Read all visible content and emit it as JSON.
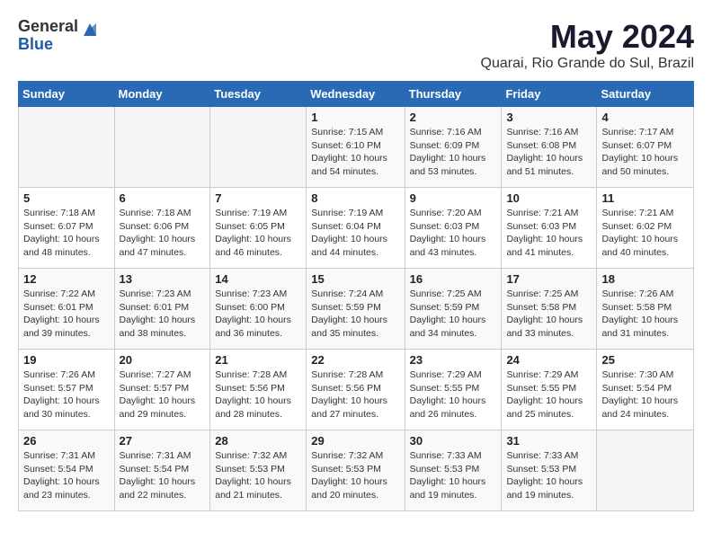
{
  "logo": {
    "line1": "General",
    "line2": "Blue"
  },
  "title": "May 2024",
  "subtitle": "Quarai, Rio Grande do Sul, Brazil",
  "weekdays": [
    "Sunday",
    "Monday",
    "Tuesday",
    "Wednesday",
    "Thursday",
    "Friday",
    "Saturday"
  ],
  "weeks": [
    [
      {
        "day": "",
        "sunrise": "",
        "sunset": "",
        "daylight": ""
      },
      {
        "day": "",
        "sunrise": "",
        "sunset": "",
        "daylight": ""
      },
      {
        "day": "",
        "sunrise": "",
        "sunset": "",
        "daylight": ""
      },
      {
        "day": "1",
        "sunrise": "Sunrise: 7:15 AM",
        "sunset": "Sunset: 6:10 PM",
        "daylight": "Daylight: 10 hours and 54 minutes."
      },
      {
        "day": "2",
        "sunrise": "Sunrise: 7:16 AM",
        "sunset": "Sunset: 6:09 PM",
        "daylight": "Daylight: 10 hours and 53 minutes."
      },
      {
        "day": "3",
        "sunrise": "Sunrise: 7:16 AM",
        "sunset": "Sunset: 6:08 PM",
        "daylight": "Daylight: 10 hours and 51 minutes."
      },
      {
        "day": "4",
        "sunrise": "Sunrise: 7:17 AM",
        "sunset": "Sunset: 6:07 PM",
        "daylight": "Daylight: 10 hours and 50 minutes."
      }
    ],
    [
      {
        "day": "5",
        "sunrise": "Sunrise: 7:18 AM",
        "sunset": "Sunset: 6:07 PM",
        "daylight": "Daylight: 10 hours and 48 minutes."
      },
      {
        "day": "6",
        "sunrise": "Sunrise: 7:18 AM",
        "sunset": "Sunset: 6:06 PM",
        "daylight": "Daylight: 10 hours and 47 minutes."
      },
      {
        "day": "7",
        "sunrise": "Sunrise: 7:19 AM",
        "sunset": "Sunset: 6:05 PM",
        "daylight": "Daylight: 10 hours and 46 minutes."
      },
      {
        "day": "8",
        "sunrise": "Sunrise: 7:19 AM",
        "sunset": "Sunset: 6:04 PM",
        "daylight": "Daylight: 10 hours and 44 minutes."
      },
      {
        "day": "9",
        "sunrise": "Sunrise: 7:20 AM",
        "sunset": "Sunset: 6:03 PM",
        "daylight": "Daylight: 10 hours and 43 minutes."
      },
      {
        "day": "10",
        "sunrise": "Sunrise: 7:21 AM",
        "sunset": "Sunset: 6:03 PM",
        "daylight": "Daylight: 10 hours and 41 minutes."
      },
      {
        "day": "11",
        "sunrise": "Sunrise: 7:21 AM",
        "sunset": "Sunset: 6:02 PM",
        "daylight": "Daylight: 10 hours and 40 minutes."
      }
    ],
    [
      {
        "day": "12",
        "sunrise": "Sunrise: 7:22 AM",
        "sunset": "Sunset: 6:01 PM",
        "daylight": "Daylight: 10 hours and 39 minutes."
      },
      {
        "day": "13",
        "sunrise": "Sunrise: 7:23 AM",
        "sunset": "Sunset: 6:01 PM",
        "daylight": "Daylight: 10 hours and 38 minutes."
      },
      {
        "day": "14",
        "sunrise": "Sunrise: 7:23 AM",
        "sunset": "Sunset: 6:00 PM",
        "daylight": "Daylight: 10 hours and 36 minutes."
      },
      {
        "day": "15",
        "sunrise": "Sunrise: 7:24 AM",
        "sunset": "Sunset: 5:59 PM",
        "daylight": "Daylight: 10 hours and 35 minutes."
      },
      {
        "day": "16",
        "sunrise": "Sunrise: 7:25 AM",
        "sunset": "Sunset: 5:59 PM",
        "daylight": "Daylight: 10 hours and 34 minutes."
      },
      {
        "day": "17",
        "sunrise": "Sunrise: 7:25 AM",
        "sunset": "Sunset: 5:58 PM",
        "daylight": "Daylight: 10 hours and 33 minutes."
      },
      {
        "day": "18",
        "sunrise": "Sunrise: 7:26 AM",
        "sunset": "Sunset: 5:58 PM",
        "daylight": "Daylight: 10 hours and 31 minutes."
      }
    ],
    [
      {
        "day": "19",
        "sunrise": "Sunrise: 7:26 AM",
        "sunset": "Sunset: 5:57 PM",
        "daylight": "Daylight: 10 hours and 30 minutes."
      },
      {
        "day": "20",
        "sunrise": "Sunrise: 7:27 AM",
        "sunset": "Sunset: 5:57 PM",
        "daylight": "Daylight: 10 hours and 29 minutes."
      },
      {
        "day": "21",
        "sunrise": "Sunrise: 7:28 AM",
        "sunset": "Sunset: 5:56 PM",
        "daylight": "Daylight: 10 hours and 28 minutes."
      },
      {
        "day": "22",
        "sunrise": "Sunrise: 7:28 AM",
        "sunset": "Sunset: 5:56 PM",
        "daylight": "Daylight: 10 hours and 27 minutes."
      },
      {
        "day": "23",
        "sunrise": "Sunrise: 7:29 AM",
        "sunset": "Sunset: 5:55 PM",
        "daylight": "Daylight: 10 hours and 26 minutes."
      },
      {
        "day": "24",
        "sunrise": "Sunrise: 7:29 AM",
        "sunset": "Sunset: 5:55 PM",
        "daylight": "Daylight: 10 hours and 25 minutes."
      },
      {
        "day": "25",
        "sunrise": "Sunrise: 7:30 AM",
        "sunset": "Sunset: 5:54 PM",
        "daylight": "Daylight: 10 hours and 24 minutes."
      }
    ],
    [
      {
        "day": "26",
        "sunrise": "Sunrise: 7:31 AM",
        "sunset": "Sunset: 5:54 PM",
        "daylight": "Daylight: 10 hours and 23 minutes."
      },
      {
        "day": "27",
        "sunrise": "Sunrise: 7:31 AM",
        "sunset": "Sunset: 5:54 PM",
        "daylight": "Daylight: 10 hours and 22 minutes."
      },
      {
        "day": "28",
        "sunrise": "Sunrise: 7:32 AM",
        "sunset": "Sunset: 5:53 PM",
        "daylight": "Daylight: 10 hours and 21 minutes."
      },
      {
        "day": "29",
        "sunrise": "Sunrise: 7:32 AM",
        "sunset": "Sunset: 5:53 PM",
        "daylight": "Daylight: 10 hours and 20 minutes."
      },
      {
        "day": "30",
        "sunrise": "Sunrise: 7:33 AM",
        "sunset": "Sunset: 5:53 PM",
        "daylight": "Daylight: 10 hours and 19 minutes."
      },
      {
        "day": "31",
        "sunrise": "Sunrise: 7:33 AM",
        "sunset": "Sunset: 5:53 PM",
        "daylight": "Daylight: 10 hours and 19 minutes."
      },
      {
        "day": "",
        "sunrise": "",
        "sunset": "",
        "daylight": ""
      }
    ]
  ]
}
